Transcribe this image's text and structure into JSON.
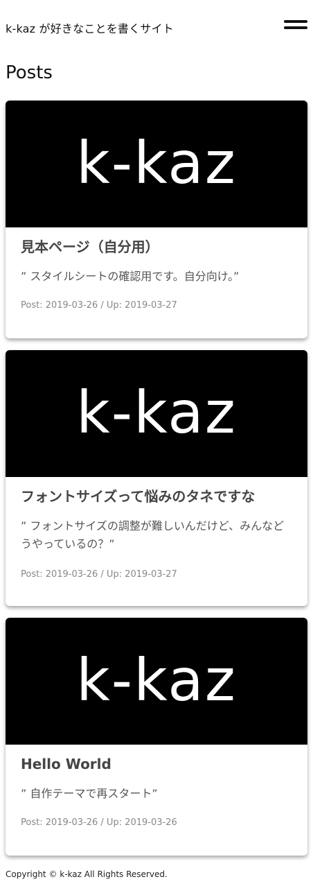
{
  "header": {
    "site_title": "k-kaz が好きなことを書くサイト",
    "menu_icon": "hamburger-menu-icon"
  },
  "main": {
    "section_title": "Posts",
    "posts": [
      {
        "thumbnail_text": "k-kaz",
        "title": "見本ページ（自分用）",
        "excerpt": "” スタイルシートの確認用です。自分向け。”",
        "meta": "Post: 2019-03-26 / Up: 2019-03-27"
      },
      {
        "thumbnail_text": "k-kaz",
        "title": "フォントサイズって悩みのタネですな",
        "excerpt": "” フォントサイズの調整が難しいんだけど、みんなどうやっているの？”",
        "meta": "Post: 2019-03-26 / Up: 2019-03-27"
      },
      {
        "thumbnail_text": "k-kaz",
        "title": "Hello World",
        "excerpt": "” 自作テーマで再スタート”",
        "meta": "Post: 2019-03-26 / Up: 2019-03-26"
      }
    ]
  },
  "footer": {
    "copyright": "Copyright © k-kaz All Rights Reserved."
  },
  "colors": {
    "thumbnail_bg": "#000000",
    "thumbnail_text": "#ffffff",
    "card_title": "#444444",
    "meta": "#888888"
  }
}
